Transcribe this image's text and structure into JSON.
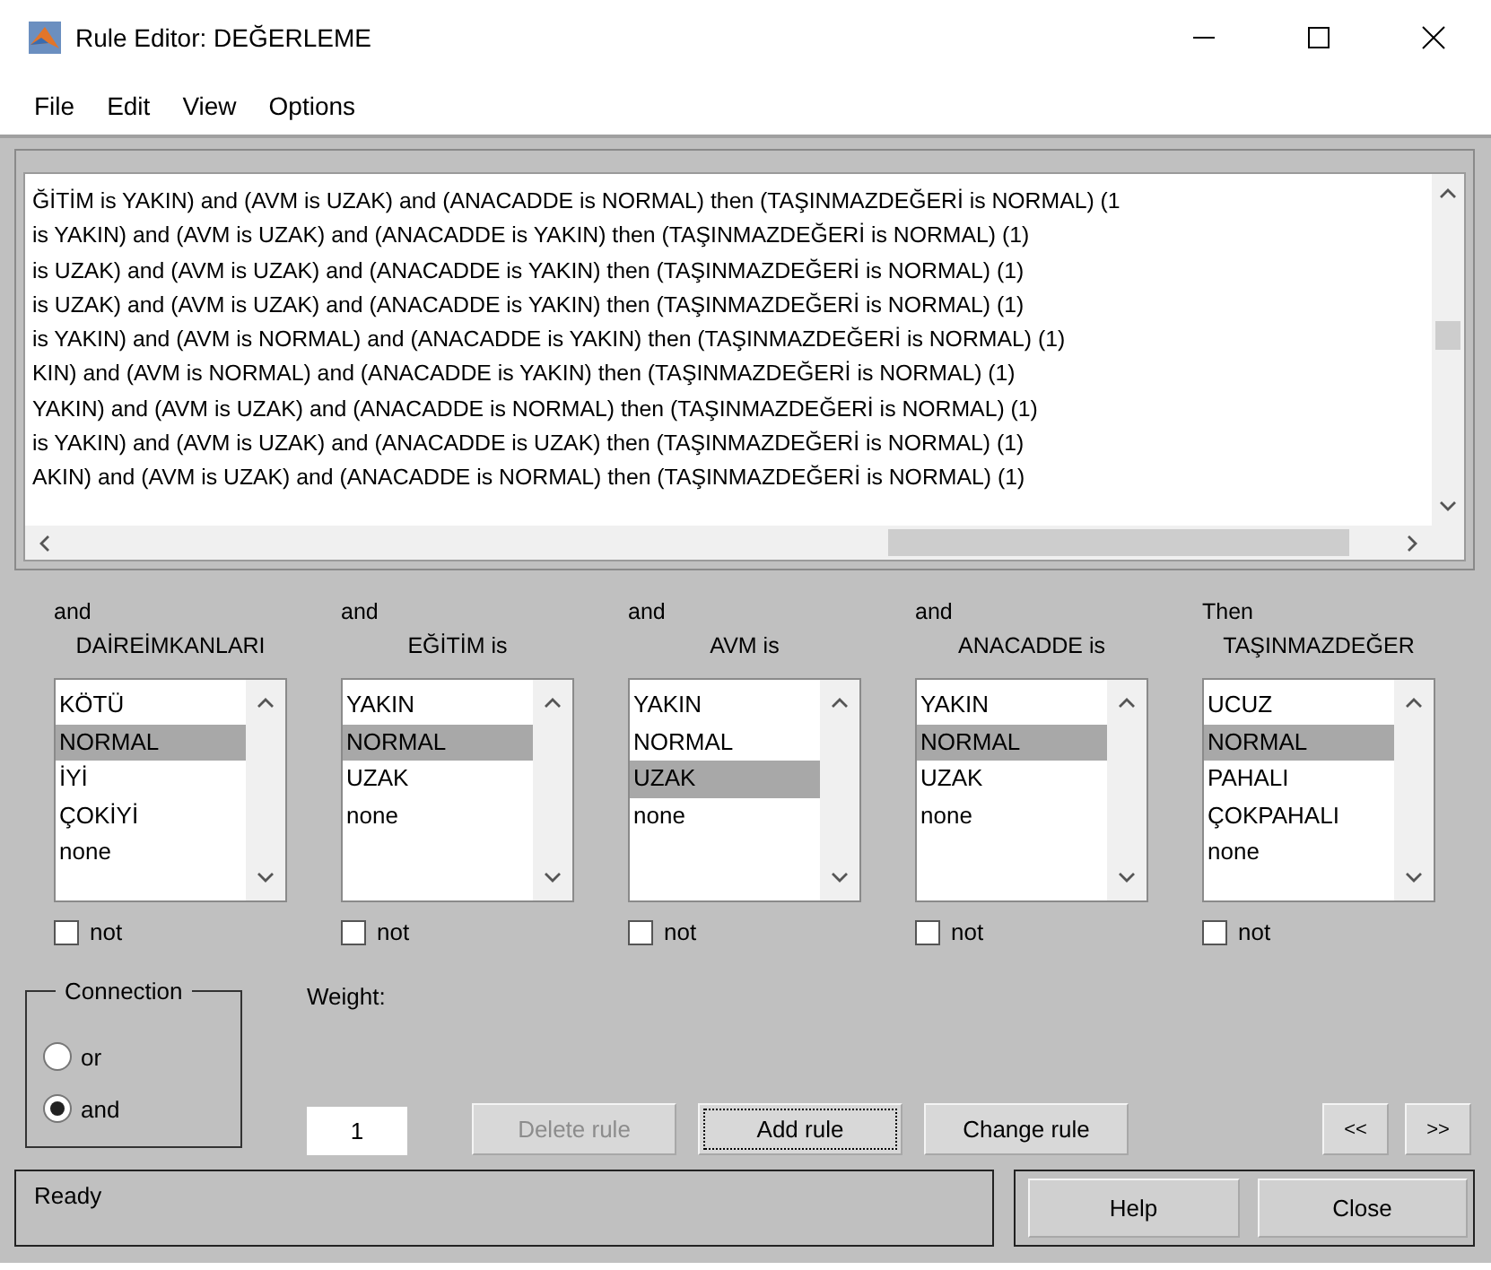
{
  "window": {
    "title": "Rule Editor: DEĞERLEME"
  },
  "menu": [
    "File",
    "Edit",
    "View",
    "Options"
  ],
  "rules": [
    "ĞİTİM is YAKIN) and (AVM is UZAK) and (ANACADDE is NORMAL) then (TAŞINMAZDEĞERİ is NORMAL) (1",
    "is YAKIN) and (AVM is UZAK) and (ANACADDE is YAKIN) then (TAŞINMAZDEĞERİ is NORMAL) (1)",
    "is UZAK) and (AVM is UZAK) and (ANACADDE is YAKIN) then (TAŞINMAZDEĞERİ is NORMAL) (1)",
    "is UZAK) and (AVM is UZAK) and (ANACADDE is YAKIN) then (TAŞINMAZDEĞERİ is NORMAL) (1)",
    "is YAKIN) and (AVM is NORMAL) and (ANACADDE is YAKIN) then (TAŞINMAZDEĞERİ is NORMAL) (1)",
    "KIN) and (AVM is NORMAL) and (ANACADDE is YAKIN) then (TAŞINMAZDEĞERİ is NORMAL) (1)",
    "YAKIN) and (AVM is UZAK) and (ANACADDE is NORMAL) then (TAŞINMAZDEĞERİ is NORMAL) (1)",
    "is YAKIN) and (AVM is UZAK) and (ANACADDE is UZAK) then (TAŞINMAZDEĞERİ is NORMAL) (1)",
    "AKIN) and (AVM is UZAK) and (ANACADDE is NORMAL) then (TAŞINMAZDEĞERİ is NORMAL) (1)"
  ],
  "variables": [
    {
      "connective": "and",
      "name": "DAİREİMKANLARI",
      "not": false,
      "not_label": "not",
      "options": [
        {
          "label": "KÖTÜ",
          "selected": false
        },
        {
          "label": "NORMAL",
          "selected": true
        },
        {
          "label": "İYİ",
          "selected": false
        },
        {
          "label": "ÇOKİYİ",
          "selected": false
        },
        {
          "label": "none",
          "selected": false
        }
      ]
    },
    {
      "connective": "and",
      "name": "EĞİTİM is",
      "not": false,
      "not_label": "not",
      "options": [
        {
          "label": "YAKIN",
          "selected": false
        },
        {
          "label": "NORMAL",
          "selected": true
        },
        {
          "label": "UZAK",
          "selected": false
        },
        {
          "label": "none",
          "selected": false
        }
      ]
    },
    {
      "connective": "and",
      "name": "AVM is",
      "not": false,
      "not_label": "not",
      "options": [
        {
          "label": "YAKIN",
          "selected": false
        },
        {
          "label": "NORMAL",
          "selected": false
        },
        {
          "label": "UZAK",
          "selected": true
        },
        {
          "label": "none",
          "selected": false
        }
      ]
    },
    {
      "connective": "and",
      "name": "ANACADDE is",
      "not": false,
      "not_label": "not",
      "options": [
        {
          "label": "YAKIN",
          "selected": false
        },
        {
          "label": "NORMAL",
          "selected": true
        },
        {
          "label": "UZAK",
          "selected": false
        },
        {
          "label": "none",
          "selected": false
        }
      ]
    },
    {
      "connective": "Then",
      "name": "TAŞINMAZDEĞER",
      "not": false,
      "not_label": "not",
      "options": [
        {
          "label": "UCUZ",
          "selected": false
        },
        {
          "label": "NORMAL",
          "selected": true
        },
        {
          "label": "PAHALI",
          "selected": false
        },
        {
          "label": "ÇOKPAHALI",
          "selected": false
        },
        {
          "label": "none",
          "selected": false
        }
      ]
    }
  ],
  "connection": {
    "title": "Connection",
    "options": [
      {
        "label": "or",
        "selected": false
      },
      {
        "label": "and",
        "selected": true
      }
    ]
  },
  "weight": {
    "label": "Weight:",
    "value": "1"
  },
  "buttons": [
    {
      "label": "Delete rule",
      "disabled": true,
      "focused": false
    },
    {
      "label": "Add rule",
      "disabled": false,
      "focused": true
    },
    {
      "label": "Change rule",
      "disabled": false,
      "focused": false
    }
  ],
  "nav_buttons": [
    "<<",
    ">>"
  ],
  "status_bar": {
    "text": "Ready",
    "buttons": [
      "Help",
      "Close"
    ]
  }
}
